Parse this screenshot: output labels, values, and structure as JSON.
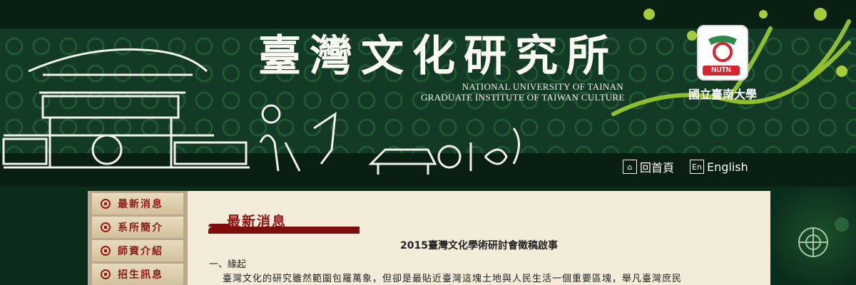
{
  "header": {
    "title": "臺灣文化研究所",
    "subtitle_line1": "NATIONAL UNIVERSITY OF TAINAN",
    "subtitle_line2": "GRADUATE INSTITUTE OF TAIWAN CULTURE",
    "logo_badge": "NUTN",
    "logo_name": "國立臺南大學",
    "nav": [
      {
        "icon": "home-icon",
        "label": "回首頁"
      },
      {
        "icon": "en-icon",
        "icon_text": "En",
        "label": "English"
      }
    ]
  },
  "sidebar": {
    "items": [
      {
        "label": "最新消息"
      },
      {
        "label": "系所簡介"
      },
      {
        "label": "師資介紹"
      },
      {
        "label": "招生訊息"
      }
    ]
  },
  "main": {
    "section_title": "最新消息",
    "article_title": "2015臺灣文化學術研討會徵稿啟事",
    "heading_1": "一、緣起",
    "paragraph_1": "臺灣文化的研究雖然範圍包羅萬象，但卻是最貼近臺灣這塊土地與人民生活一個重要區塊，舉凡臺灣庶民"
  },
  "colors": {
    "background": "#0b2b1b",
    "accent_red": "#8f1111",
    "content_bg": "#f3ecd9",
    "sidebar_bg": "#b8a98c"
  }
}
